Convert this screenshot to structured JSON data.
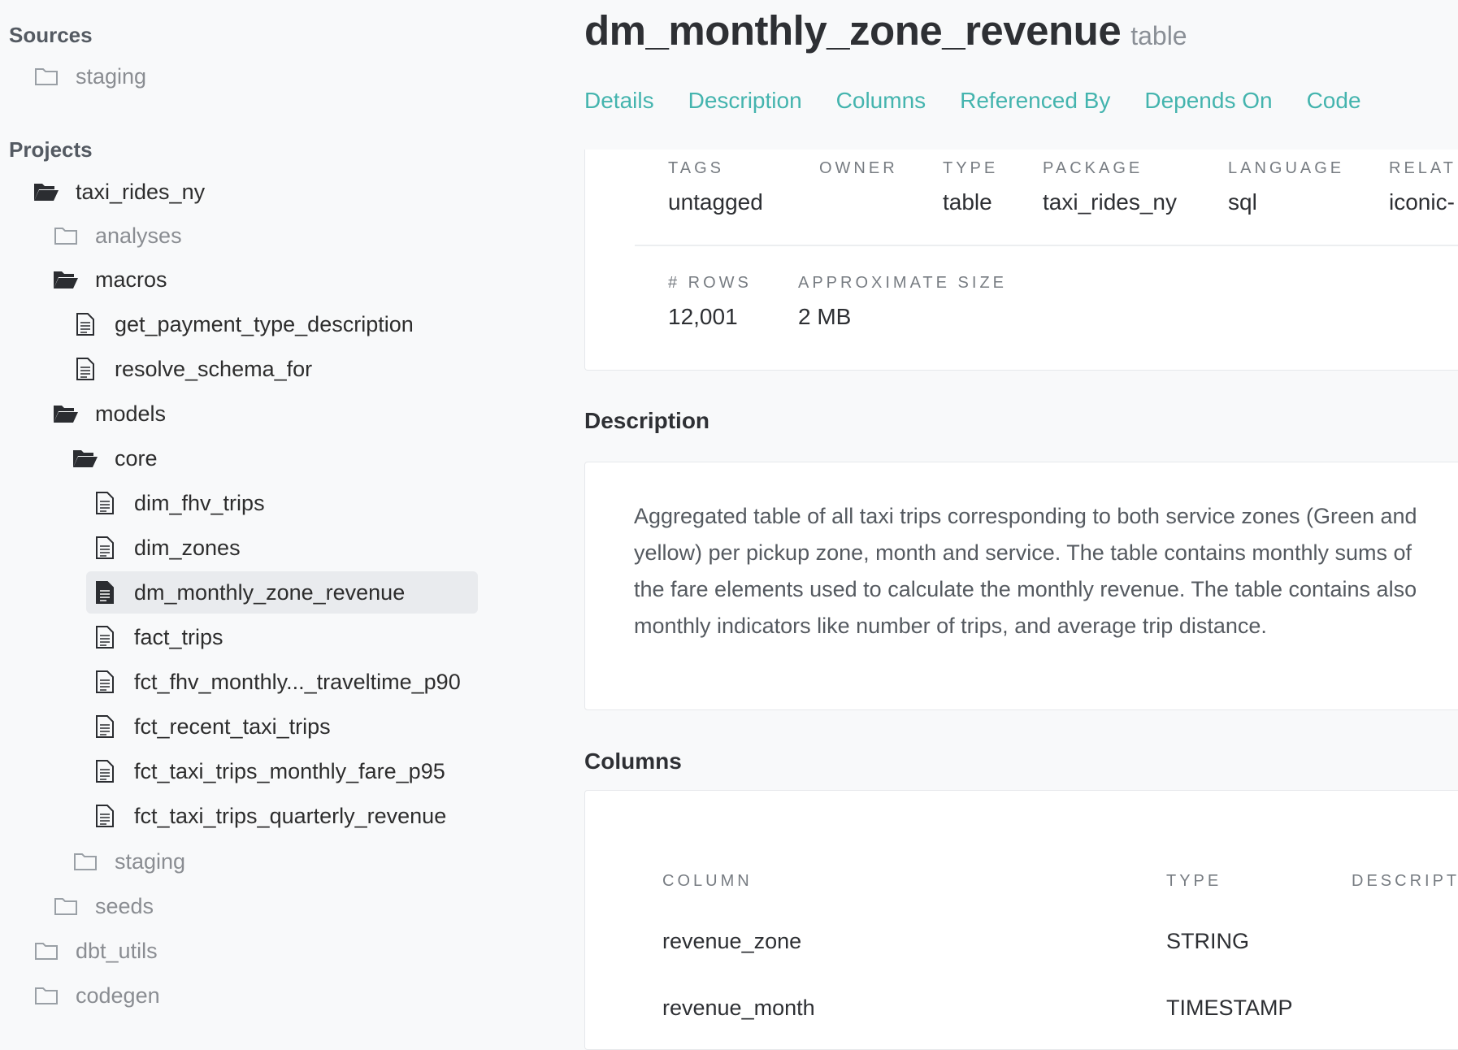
{
  "sidebar": {
    "sources_heading": "Sources",
    "sources": [
      {
        "label": "staging",
        "icon": "folder-outline-icon"
      }
    ],
    "projects_heading": "Projects",
    "projects": [
      {
        "label": "taxi_rides_ny",
        "icon": "folder-open-icon"
      },
      {
        "label": "analyses",
        "icon": "folder-outline-icon"
      },
      {
        "label": "macros",
        "icon": "folder-open-icon"
      },
      {
        "label": "get_payment_type_description",
        "icon": "file-icon"
      },
      {
        "label": "resolve_schema_for",
        "icon": "file-icon"
      },
      {
        "label": "models",
        "icon": "folder-open-icon"
      },
      {
        "label": "core",
        "icon": "folder-open-icon"
      },
      {
        "label": "dim_fhv_trips",
        "icon": "file-icon"
      },
      {
        "label": "dim_zones",
        "icon": "file-icon"
      },
      {
        "label": "dm_monthly_zone_revenue",
        "icon": "file-filled-icon",
        "selected": true
      },
      {
        "label": "fact_trips",
        "icon": "file-icon"
      },
      {
        "label": "fct_fhv_monthly..._traveltime_p90",
        "icon": "file-icon"
      },
      {
        "label": "fct_recent_taxi_trips",
        "icon": "file-icon"
      },
      {
        "label": "fct_taxi_trips_monthly_fare_p95",
        "icon": "file-icon"
      },
      {
        "label": "fct_taxi_trips_quarterly_revenue",
        "icon": "file-icon"
      },
      {
        "label": "staging",
        "icon": "folder-outline-icon"
      },
      {
        "label": "seeds",
        "icon": "folder-outline-icon"
      },
      {
        "label": "dbt_utils",
        "icon": "folder-outline-icon"
      },
      {
        "label": "codegen",
        "icon": "folder-outline-icon"
      }
    ]
  },
  "header": {
    "title": "dm_monthly_zone_revenue",
    "subtitle": "table"
  },
  "tabs": [
    "Details",
    "Description",
    "Columns",
    "Referenced By",
    "Depends On",
    "Code"
  ],
  "details": {
    "tags_label": "TAGS",
    "tags_value": "untagged",
    "owner_label": "OWNER",
    "owner_value": "",
    "type_label": "TYPE",
    "type_value": "table",
    "package_label": "PACKAGE",
    "package_value": "taxi_rides_ny",
    "language_label": "LANGUAGE",
    "language_value": "sql",
    "relation_label": "RELAT",
    "relation_value": "iconic-",
    "rows_label": "# ROWS",
    "rows_value": "12,001",
    "size_label": "APPROXIMATE SIZE",
    "size_value": "2 MB"
  },
  "description": {
    "heading": "Description",
    "text": "Aggregated table of all taxi trips corresponding to both service zones (Green and yellow) per pickup zone, month and service. The table contains monthly sums of the fare elements used to calculate the monthly revenue. The table contains also monthly indicators like number of trips, and average trip distance."
  },
  "columns": {
    "heading": "Columns",
    "headers": {
      "column": "COLUMN",
      "type": "TYPE",
      "description": "DESCRIPT"
    },
    "rows": [
      {
        "name": "revenue_zone",
        "type": "STRING"
      },
      {
        "name": "revenue_month",
        "type": "TIMESTAMP"
      }
    ]
  },
  "colors": {
    "accent": "#44b4ae",
    "selected_row": "#e9ebee",
    "background": "#f8f9fa"
  }
}
